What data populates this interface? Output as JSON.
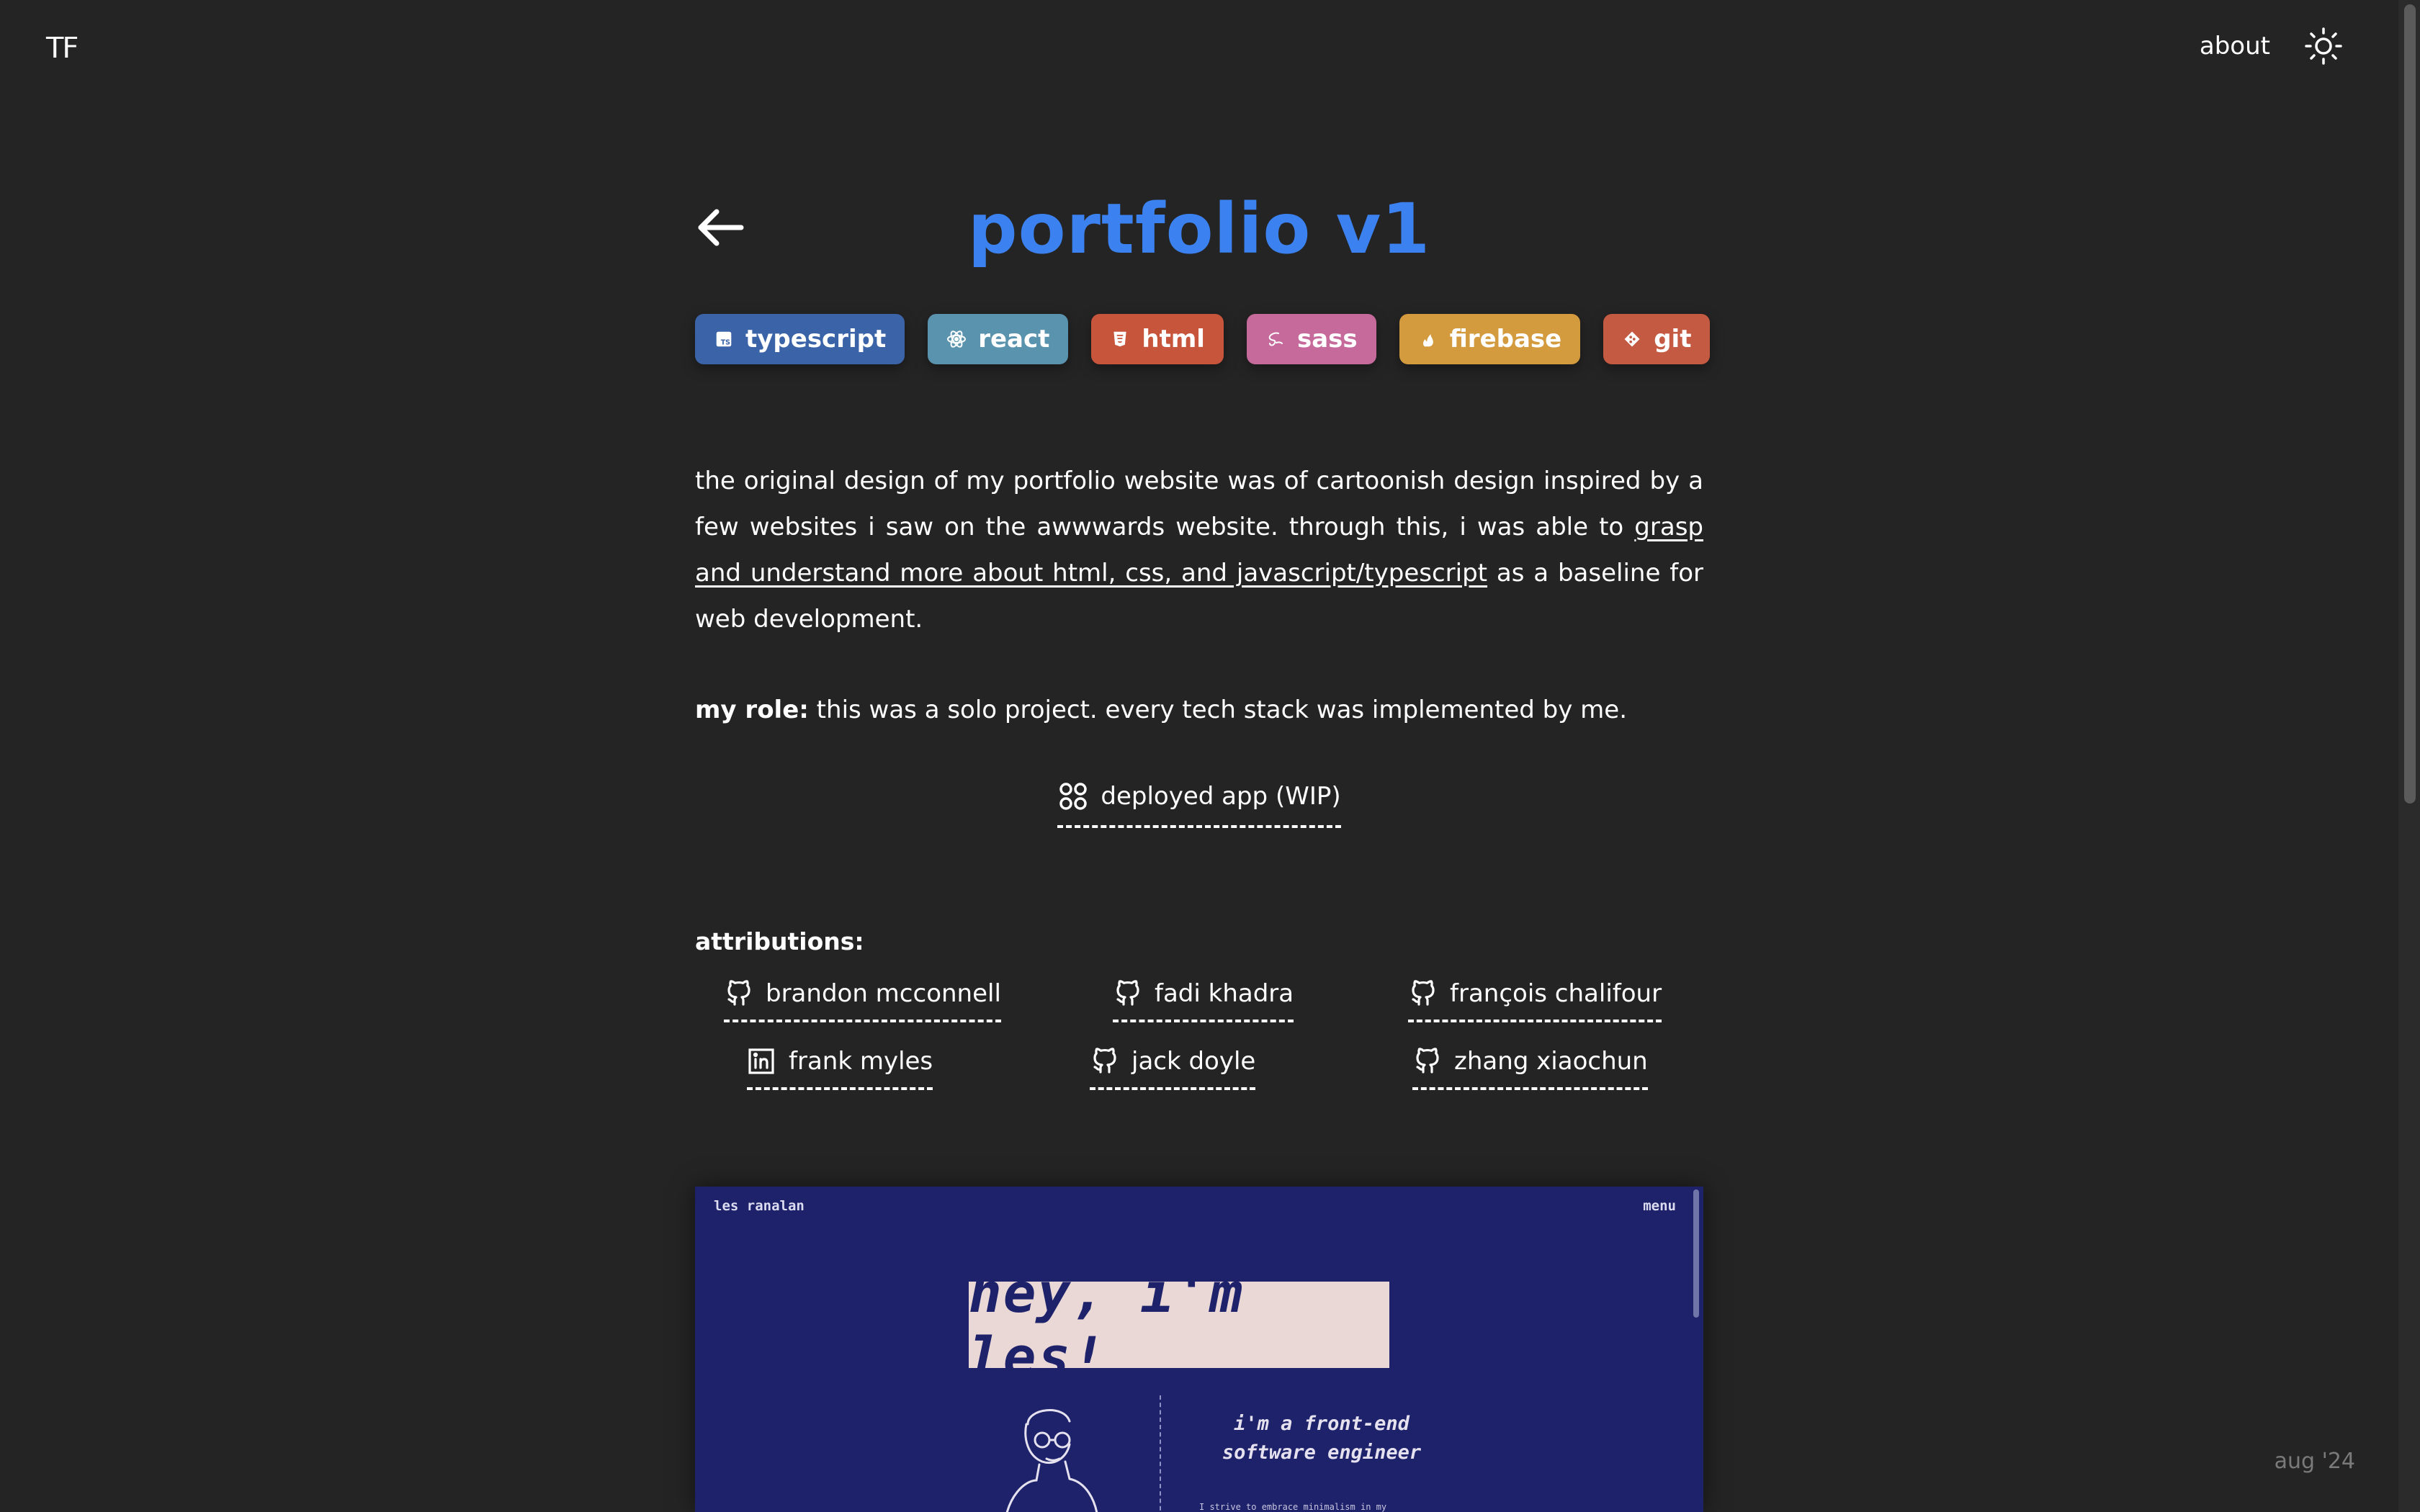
{
  "nav": {
    "logo": "ꓔꓝ",
    "about": "about"
  },
  "project": {
    "title": "portfolio v1",
    "tags": [
      {
        "label": "typescript",
        "color": "#3a63a8",
        "icon": "typescript-icon"
      },
      {
        "label": "react",
        "color": "#5a93ad",
        "icon": "react-icon"
      },
      {
        "label": "html",
        "color": "#c7553c",
        "icon": "html5-icon"
      },
      {
        "label": "sass",
        "color": "#c66a9c",
        "icon": "sass-icon"
      },
      {
        "label": "firebase",
        "color": "#d49b3e",
        "icon": "firebase-icon"
      },
      {
        "label": "git",
        "color": "#c55a42",
        "icon": "git-icon"
      }
    ],
    "description_pre": "the original design of my portfolio website was of cartoonish design inspired by a few websites i saw on the awwwards website. through this, i was able to ",
    "description_link": "grasp and understand more about html, css, and javascript/typescript",
    "description_post": " as a baseline for web development.",
    "role_label": "my role:",
    "role_text": " this was a solo project. every tech stack was implemented by me.",
    "deployed_label": "deployed app (WIP)"
  },
  "attributions": {
    "title": "attributions:",
    "items": [
      {
        "name": "brandon mcconnell",
        "icon": "github-icon"
      },
      {
        "name": "fadi khadra",
        "icon": "github-icon"
      },
      {
        "name": "françois chalifour",
        "icon": "github-icon"
      },
      {
        "name": "frank myles",
        "icon": "linkedin-icon"
      },
      {
        "name": "jack doyle",
        "icon": "github-icon"
      },
      {
        "name": "zhang xiaochun",
        "icon": "github-icon"
      }
    ]
  },
  "preview": {
    "brand": "les ranalan",
    "menu": "menu",
    "headline": "hey, i'm les!",
    "role_line1": "i'm a front-end",
    "role_line2": "software engineer",
    "small_text": "I strive to embrace minimalism in my"
  },
  "footer": {
    "date": "aug '24"
  },
  "colors": {
    "background": "#242424",
    "accent": "#3b82f0",
    "preview_bg": "#1d226b",
    "preview_highlight": "#ead8d6"
  }
}
